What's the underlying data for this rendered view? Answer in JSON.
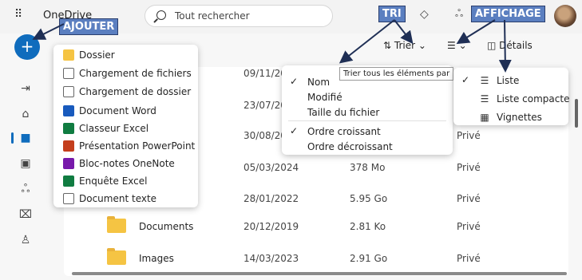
{
  "header": {
    "app_name": "OneDrive",
    "search_placeholder": "Tout rechercher"
  },
  "callouts": {
    "add": "AJOUTER",
    "sort": "TRI",
    "view": "AFFICHAGE"
  },
  "toolbar": {
    "sort_label": "Trier",
    "details_label": "Détails"
  },
  "add_menu": [
    {
      "label": "Dossier",
      "icon": "folder-icon",
      "color": "#f5c443"
    },
    {
      "label": "Chargement de fichiers",
      "icon": "file-upload-icon",
      "color": "#ffffff"
    },
    {
      "label": "Chargement de dossier",
      "icon": "folder-upload-icon",
      "color": "#ffffff"
    },
    {
      "label": "Document Word",
      "icon": "word-icon",
      "color": "#185abd"
    },
    {
      "label": "Classeur Excel",
      "icon": "excel-icon",
      "color": "#107c41"
    },
    {
      "label": "Présentation PowerPoint",
      "icon": "powerpoint-icon",
      "color": "#c43e1c"
    },
    {
      "label": "Bloc-notes OneNote",
      "icon": "onenote-icon",
      "color": "#7719aa"
    },
    {
      "label": "Enquête Excel",
      "icon": "excel-survey-icon",
      "color": "#107c41"
    },
    {
      "label": "Document texte",
      "icon": "text-doc-icon",
      "color": "#ffffff"
    }
  ],
  "sort_menu": {
    "tooltip": "Trier tous les éléments par",
    "fields": [
      "Nom",
      "Modifié",
      "Taille du fichier"
    ],
    "orders": [
      "Ordre croissant",
      "Ordre décroissant"
    ]
  },
  "view_menu": [
    "Liste",
    "Liste compacte",
    "Vignettes"
  ],
  "rows": [
    {
      "name": "",
      "date": "09/11/20",
      "size": "",
      "share": ""
    },
    {
      "name": "",
      "date": "23/07/20",
      "size": "",
      "share": ""
    },
    {
      "name": "",
      "date": "30/08/20",
      "size": "",
      "share": "Privé"
    },
    {
      "name": "",
      "date": "05/03/2024",
      "size": "378 Mo",
      "share": "Privé"
    },
    {
      "name": "",
      "date": "28/01/2022",
      "size": "5.95 Go",
      "share": "Privé"
    },
    {
      "name": "Documents",
      "date": "20/12/2019",
      "size": "2.81 Ko",
      "share": "Privé"
    },
    {
      "name": "Images",
      "date": "14/03/2023",
      "size": "2.91 Go",
      "share": "Privé"
    }
  ]
}
